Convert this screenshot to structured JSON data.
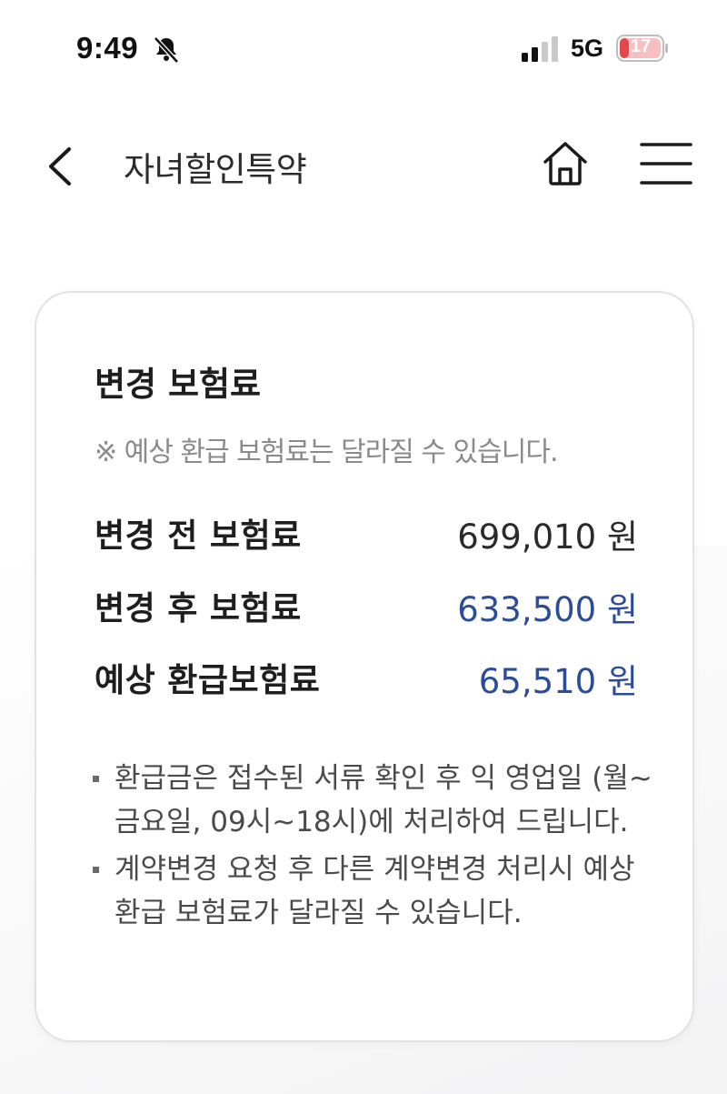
{
  "status_bar": {
    "time": "9:49",
    "network": "5G",
    "battery": "17"
  },
  "nav": {
    "title": "자녀할인특약"
  },
  "card": {
    "title": "변경 보험료",
    "note": "※ 예상 환급 보험료는 달라질 수 있습니다.",
    "rows": [
      {
        "label": "변경 전 보험료",
        "value": "699,010 원"
      },
      {
        "label": "변경 후 보험료",
        "value": "633,500 원"
      },
      {
        "label": "예상 환급보험료",
        "value": "65,510 원"
      }
    ],
    "notes": [
      "환급금은 접수된 서류 확인 후 익 영업일 (월~금요일, 09시~18시)에 처리하여 드립니다.",
      "계약변경 요청 후 다른 계약변경 처리시 예상 환급 보험료가 달라질 수 있습니다."
    ]
  },
  "colors": {
    "accent_blue": "#2d4c97",
    "battery_red": "#e5484d"
  }
}
